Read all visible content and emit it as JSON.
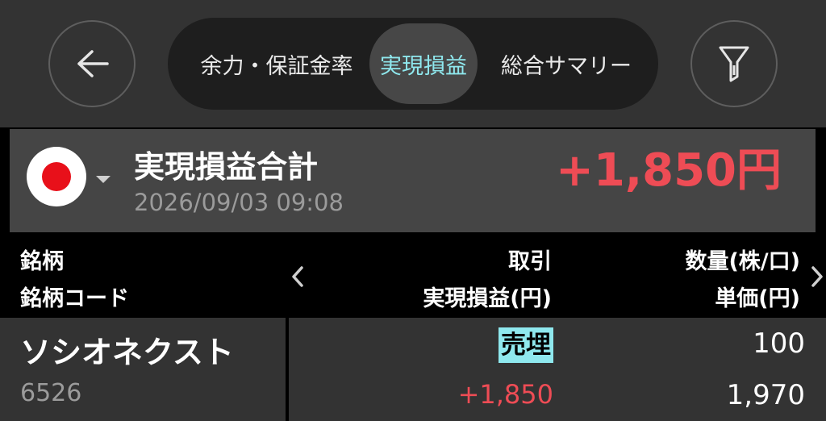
{
  "header": {
    "back_icon": "arrow-left-icon",
    "filter_icon": "filter-icon",
    "tabs": [
      {
        "label": "余力・保証金率",
        "selected": false
      },
      {
        "label": "実現損益",
        "selected": true
      },
      {
        "label": "総合サマリー",
        "selected": false
      }
    ]
  },
  "summary": {
    "flag_icon": "japan-flag-icon",
    "title": "実現損益合計",
    "date": "2026/09/03 09:08",
    "total": "+1,850円"
  },
  "columns": {
    "name": "銘柄",
    "code": "銘柄コード",
    "trade": "取引",
    "realized_pl": "実現損益(円)",
    "quantity": "数量(株/口)",
    "unit_price": "単価(円)"
  },
  "rows": [
    {
      "name": "ソシオネクスト",
      "code": "6526",
      "trade": "売埋",
      "realized_pl": "+1,850",
      "quantity": "100",
      "unit_price": "1,970"
    }
  ],
  "colors": {
    "accent": "#8fe8ee",
    "profit": "#ee4c55",
    "header_bg": "#333333",
    "panel_bg": "#454545"
  }
}
